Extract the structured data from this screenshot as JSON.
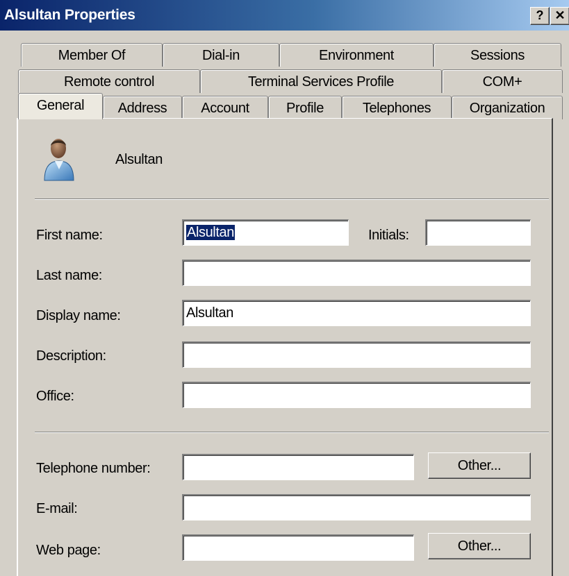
{
  "window": {
    "title": "Alsultan Properties",
    "help_button": "?",
    "close_button": "✕"
  },
  "tabs": {
    "row1": [
      "Member Of",
      "Dial-in",
      "Environment",
      "Sessions"
    ],
    "row2": [
      "Remote control",
      "Terminal Services Profile",
      "COM+"
    ],
    "row3": [
      "General",
      "Address",
      "Account",
      "Profile",
      "Telephones",
      "Organization"
    ],
    "active": "General"
  },
  "general": {
    "user_display": "Alsultan",
    "first_name_label": "First name:",
    "first_name_value": "Alsultan",
    "initials_label": "Initials:",
    "initials_value": "",
    "last_name_label": "Last name:",
    "last_name_value": "",
    "display_name_label": "Display name:",
    "display_name_value": "Alsultan",
    "description_label": "Description:",
    "description_value": "",
    "office_label": "Office:",
    "office_value": "",
    "telephone_label": "Telephone number:",
    "telephone_value": "",
    "telephone_other_button": "Other...",
    "email_label": "E-mail:",
    "email_value": "",
    "web_page_label": "Web page:",
    "web_page_value": "",
    "web_page_other_button": "Other..."
  },
  "icons": {
    "user": "user-icon"
  },
  "colors": {
    "titlebar_start": "#0a246a",
    "titlebar_end": "#a6caf0",
    "dialog_background": "#d4d0c8",
    "selection": "#0a246a"
  }
}
